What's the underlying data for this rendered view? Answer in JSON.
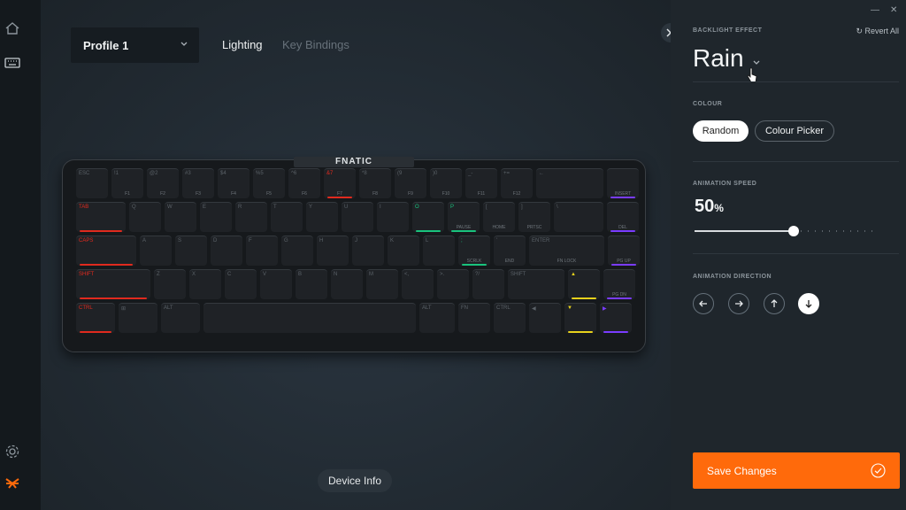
{
  "sidebar": {
    "icons": [
      "home-icon",
      "keyboard-icon",
      "settings-icon",
      "fnatic-logo-icon"
    ]
  },
  "header": {
    "profile": "Profile 1",
    "tabs": [
      {
        "label": "Lighting",
        "active": true
      },
      {
        "label": "Key Bindings",
        "active": false
      }
    ]
  },
  "device": {
    "brand": "FNATIC",
    "device_info_label": "Device Info"
  },
  "panel": {
    "backlight_label": "BACKLIGHT EFFECT",
    "revert_label": "Revert All",
    "effect_value": "Rain",
    "colour_label": "COLOUR",
    "colour_options": [
      "Random",
      "Colour Picker"
    ],
    "colour_selected": "Random",
    "speed_label": "ANIMATION SPEED",
    "speed_value": "50",
    "speed_unit": "%",
    "speed_fraction": 0.5,
    "direction_label": "ANIMATION DIRECTION",
    "directions": [
      "left",
      "right",
      "up",
      "down"
    ],
    "direction_selected": "down",
    "save_label": "Save Changes"
  },
  "colors": {
    "accent": "#ff6a0b",
    "panel_bg": "#1f262c",
    "key_red": "#e02a1e",
    "key_green": "#19c37d",
    "key_purple": "#7a3cff",
    "key_yellow": "#e8d21c"
  },
  "keyboard": {
    "rows": [
      [
        [
          "ESC",
          ""
        ],
        [
          "!1",
          "F1"
        ],
        [
          "@2",
          "F2"
        ],
        [
          "#3",
          "F3"
        ],
        [
          "$4",
          "F4"
        ],
        [
          "%5",
          "F5"
        ],
        [
          "^6",
          "F6"
        ],
        [
          "&7",
          "F7"
        ],
        [
          "*8",
          "F8"
        ],
        [
          "(9",
          "F9"
        ],
        [
          ")0",
          "F10"
        ],
        [
          "_-",
          "F11"
        ],
        [
          "+=",
          "F12"
        ],
        [
          "←",
          ""
        ],
        [
          "",
          "INSERT"
        ]
      ],
      [
        [
          "TAB",
          ""
        ],
        [
          "Q",
          ""
        ],
        [
          "W",
          ""
        ],
        [
          "E",
          ""
        ],
        [
          "R",
          ""
        ],
        [
          "T",
          ""
        ],
        [
          "Y",
          ""
        ],
        [
          "U",
          ""
        ],
        [
          "I",
          ""
        ],
        [
          "O",
          ""
        ],
        [
          "P",
          "PAUSE"
        ],
        [
          "[",
          "HOME"
        ],
        [
          "]",
          "PRTSC"
        ],
        [
          "\\",
          ""
        ],
        [
          "",
          "DEL"
        ]
      ],
      [
        [
          "CAPS",
          ""
        ],
        [
          "A",
          ""
        ],
        [
          "S",
          ""
        ],
        [
          "D",
          ""
        ],
        [
          "F",
          ""
        ],
        [
          "G",
          ""
        ],
        [
          "H",
          ""
        ],
        [
          "J",
          ""
        ],
        [
          "K",
          ""
        ],
        [
          "L",
          ""
        ],
        [
          ";",
          "SCRLK"
        ],
        [
          "'",
          "END"
        ],
        [
          "ENTER",
          "FN LOCK"
        ],
        [
          "",
          "PG UP"
        ]
      ],
      [
        [
          "SHIFT",
          ""
        ],
        [
          "Z",
          ""
        ],
        [
          "X",
          ""
        ],
        [
          "C",
          ""
        ],
        [
          "V",
          ""
        ],
        [
          "B",
          ""
        ],
        [
          "N",
          ""
        ],
        [
          "M",
          ""
        ],
        [
          "<,",
          ""
        ],
        [
          ">.",
          ""
        ],
        [
          "?/",
          ""
        ],
        [
          "SHIFT",
          ""
        ],
        [
          "▲",
          ""
        ],
        [
          "",
          "PG DN"
        ]
      ],
      [
        [
          "CTRL",
          ""
        ],
        [
          "⊞",
          ""
        ],
        [
          "ALT",
          ""
        ],
        [
          "",
          ""
        ],
        [
          "ALT",
          ""
        ],
        [
          "FN",
          ""
        ],
        [
          "CTRL",
          ""
        ],
        [
          "◀",
          ""
        ],
        [
          "▼",
          ""
        ],
        [
          "▶",
          ""
        ]
      ]
    ]
  }
}
